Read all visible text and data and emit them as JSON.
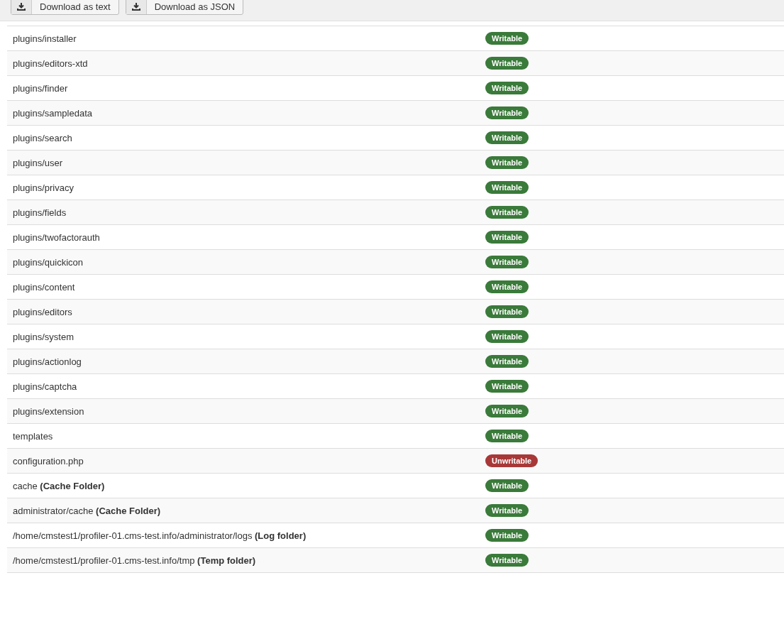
{
  "toolbar": {
    "buttons": [
      {
        "label": "Download as text"
      },
      {
        "label": "Download as JSON"
      }
    ]
  },
  "rows": [
    {
      "directory": "plugins/installer",
      "status": "Writable",
      "kind": "ok"
    },
    {
      "directory": "plugins/editors-xtd",
      "status": "Writable",
      "kind": "ok"
    },
    {
      "directory": "plugins/finder",
      "status": "Writable",
      "kind": "ok"
    },
    {
      "directory": "plugins/sampledata",
      "status": "Writable",
      "kind": "ok"
    },
    {
      "directory": "plugins/search",
      "status": "Writable",
      "kind": "ok"
    },
    {
      "directory": "plugins/user",
      "status": "Writable",
      "kind": "ok"
    },
    {
      "directory": "plugins/privacy",
      "status": "Writable",
      "kind": "ok"
    },
    {
      "directory": "plugins/fields",
      "status": "Writable",
      "kind": "ok"
    },
    {
      "directory": "plugins/twofactorauth",
      "status": "Writable",
      "kind": "ok"
    },
    {
      "directory": "plugins/quickicon",
      "status": "Writable",
      "kind": "ok"
    },
    {
      "directory": "plugins/content",
      "status": "Writable",
      "kind": "ok"
    },
    {
      "directory": "plugins/editors",
      "status": "Writable",
      "kind": "ok"
    },
    {
      "directory": "plugins/system",
      "status": "Writable",
      "kind": "ok"
    },
    {
      "directory": "plugins/actionlog",
      "status": "Writable",
      "kind": "ok"
    },
    {
      "directory": "plugins/captcha",
      "status": "Writable",
      "kind": "ok"
    },
    {
      "directory": "plugins/extension",
      "status": "Writable",
      "kind": "ok"
    },
    {
      "directory": "templates",
      "status": "Writable",
      "kind": "ok"
    },
    {
      "directory": "configuration.php",
      "status": "Unwritable",
      "kind": "error"
    },
    {
      "directory": "cache **(Cache Folder)**",
      "status": "Writable",
      "kind": "ok"
    },
    {
      "directory": "administrator/cache **(Cache Folder)**",
      "status": "Writable",
      "kind": "ok"
    },
    {
      "directory": "/home/cmstest1/profiler-01.cms-test.info/administrator/logs **(Log folder)**",
      "status": "Writable",
      "kind": "ok"
    },
    {
      "directory": "/home/cmstest1/profiler-01.cms-test.info/tmp **(Temp folder)**",
      "status": "Writable",
      "kind": "ok"
    }
  ]
}
